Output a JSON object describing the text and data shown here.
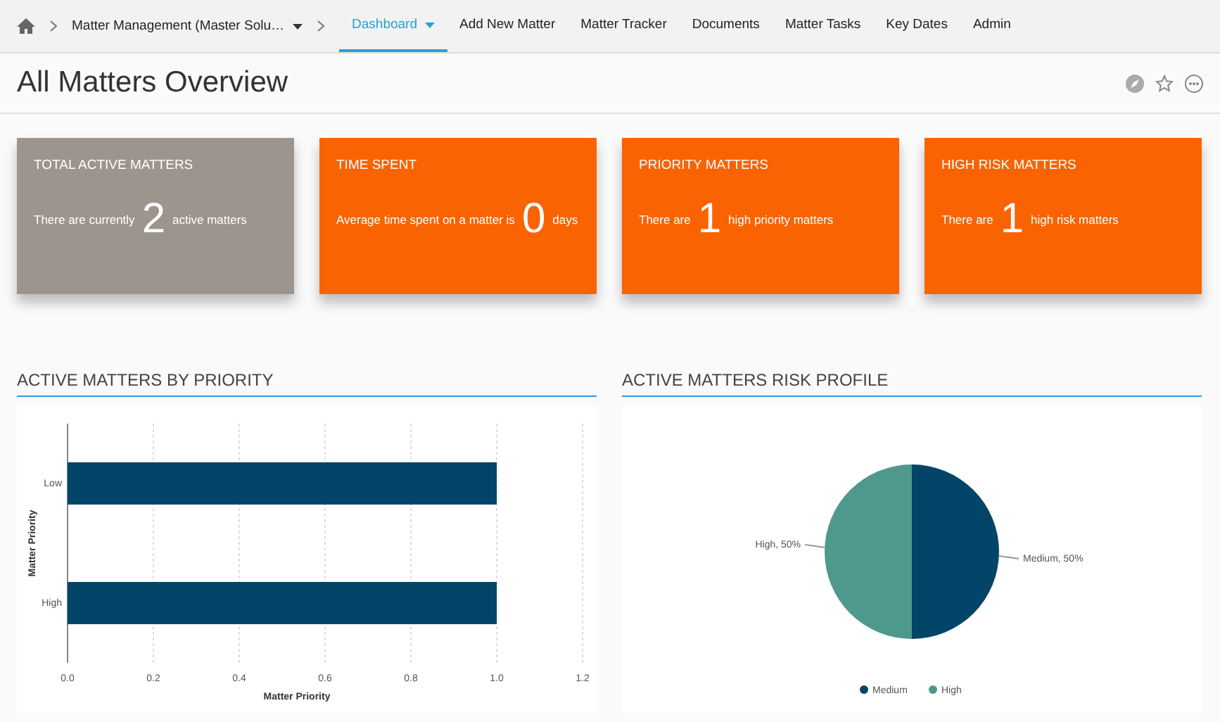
{
  "nav": {
    "breadcrumb": "Matter Management (Master Solu…",
    "tabs": [
      {
        "label": "Dashboard",
        "selected": true,
        "dropdown": true
      },
      {
        "label": "Add New Matter",
        "selected": false,
        "dropdown": false
      },
      {
        "label": "Matter Tracker",
        "selected": false,
        "dropdown": false
      },
      {
        "label": "Documents",
        "selected": false,
        "dropdown": false
      },
      {
        "label": "Matter Tasks",
        "selected": false,
        "dropdown": false
      },
      {
        "label": "Key Dates",
        "selected": false,
        "dropdown": false
      },
      {
        "label": "Admin",
        "selected": false,
        "dropdown": false
      }
    ]
  },
  "page_title": "All Matters Overview",
  "cards": [
    {
      "title": "TOTAL ACTIVE MATTERS",
      "prefix": "There are currently",
      "value": "2",
      "suffix": "active matters",
      "color": "#9b958e"
    },
    {
      "title": "TIME SPENT",
      "prefix": "Average time spent on a matter is",
      "value": "0",
      "suffix": "days",
      "color": "#f96302"
    },
    {
      "title": "PRIORITY MATTERS",
      "prefix": "There are",
      "value": "1",
      "suffix": "high priority matters",
      "color": "#f96302"
    },
    {
      "title": "HIGH RISK MATTERS",
      "prefix": "There are",
      "value": "1",
      "suffix": "high risk matters",
      "color": "#f96302"
    }
  ],
  "panels": [
    {
      "heading": "ACTIVE MATTERS BY PRIORITY",
      "chart_data": {
        "type": "bar",
        "orientation": "horizontal",
        "categories": [
          "Low",
          "High"
        ],
        "values": [
          1,
          1
        ],
        "color": "#034569",
        "grid": true,
        "xlabel": "Matter Priority",
        "ylabel": "Matter Priority",
        "xlim": [
          0,
          1.2
        ],
        "xticks": [
          {
            "value": 0,
            "label": "0.0"
          },
          {
            "value": 0.2,
            "label": "0.2"
          },
          {
            "value": 0.4,
            "label": "0.4"
          },
          {
            "value": 0.6,
            "label": "0.6"
          },
          {
            "value": 0.8,
            "label": "0.8"
          },
          {
            "value": 1,
            "label": "1.0"
          },
          {
            "value": 1.2,
            "label": "1.2"
          }
        ]
      }
    },
    {
      "heading": "ACTIVE MATTERS RISK PROFILE",
      "chart_data": {
        "type": "pie",
        "categories": [
          "Medium",
          "High"
        ],
        "values": [
          50,
          50
        ],
        "legend": true,
        "colors": [
          "#034569",
          "#4e988c"
        ],
        "value_labels": [
          "Medium, 50%",
          "High, 50%"
        ]
      }
    }
  ]
}
